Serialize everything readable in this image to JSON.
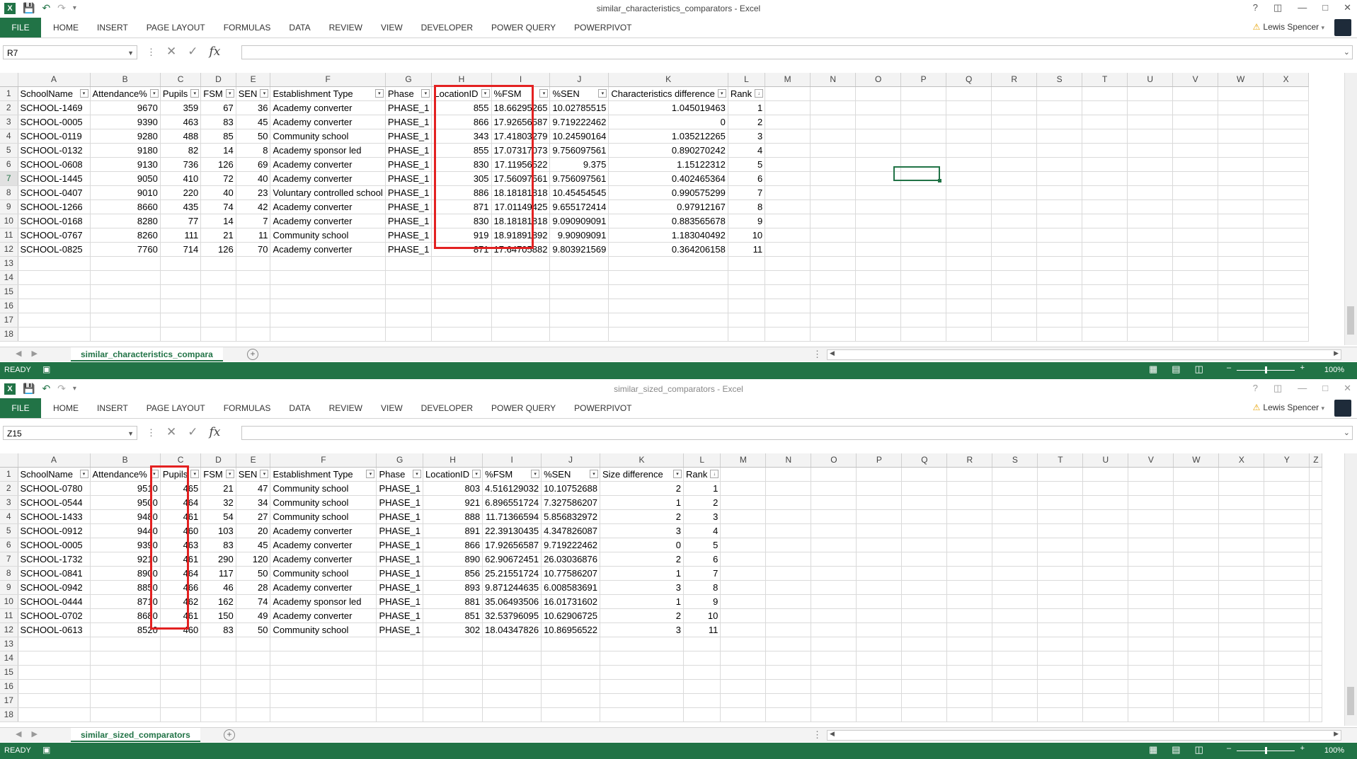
{
  "app": {
    "user_name": "Lewis Spencer",
    "file_tab": "FILE",
    "ribbon_tabs": [
      "HOME",
      "INSERT",
      "PAGE LAYOUT",
      "FORMULAS",
      "DATA",
      "REVIEW",
      "VIEW",
      "DEVELOPER",
      "POWER QUERY",
      "POWERPIVOT"
    ],
    "status_text": "READY",
    "zoom_level": "100%",
    "accent_color": "#217346",
    "highlight_color": "#e32121"
  },
  "window1": {
    "title": "similar_characteristics_comparators - Excel",
    "name_box": "R7",
    "sheet_tab": "similar_characteristics_compara",
    "column_letters": [
      "A",
      "B",
      "C",
      "D",
      "E",
      "F",
      "G",
      "H",
      "I",
      "J",
      "K",
      "L",
      "M",
      "N",
      "O",
      "P",
      "Q",
      "R",
      "S",
      "T",
      "U",
      "V",
      "W",
      "X"
    ],
    "headers": [
      "SchoolName",
      "Attendance%",
      "Pupils",
      "FSM",
      "SEN",
      "Establishment Type",
      "Phase",
      "LocationID",
      "%FSM",
      "%SEN",
      "Characteristics difference",
      "Rank"
    ],
    "rows": [
      [
        "SCHOOL-1469",
        "9670",
        "359",
        "67",
        "36",
        "Academy converter",
        "PHASE_1",
        "855",
        "18.66295265",
        "10.02785515",
        "1.045019463",
        "1"
      ],
      [
        "SCHOOL-0005",
        "9390",
        "463",
        "83",
        "45",
        "Academy converter",
        "PHASE_1",
        "866",
        "17.92656587",
        "9.719222462",
        "0",
        "2"
      ],
      [
        "SCHOOL-0119",
        "9280",
        "488",
        "85",
        "50",
        "Community school",
        "PHASE_1",
        "343",
        "17.41803279",
        "10.24590164",
        "1.035212265",
        "3"
      ],
      [
        "SCHOOL-0132",
        "9180",
        "82",
        "14",
        "8",
        "Academy sponsor led",
        "PHASE_1",
        "855",
        "17.07317073",
        "9.756097561",
        "0.890270242",
        "4"
      ],
      [
        "SCHOOL-0608",
        "9130",
        "736",
        "126",
        "69",
        "Academy converter",
        "PHASE_1",
        "830",
        "17.11956522",
        "9.375",
        "1.15122312",
        "5"
      ],
      [
        "SCHOOL-1445",
        "9050",
        "410",
        "72",
        "40",
        "Academy converter",
        "PHASE_1",
        "305",
        "17.56097561",
        "9.756097561",
        "0.402465364",
        "6"
      ],
      [
        "SCHOOL-0407",
        "9010",
        "220",
        "40",
        "23",
        "Voluntary controlled school",
        "PHASE_1",
        "886",
        "18.18181818",
        "10.45454545",
        "0.990575299",
        "7"
      ],
      [
        "SCHOOL-1266",
        "8660",
        "435",
        "74",
        "42",
        "Academy converter",
        "PHASE_1",
        "871",
        "17.01149425",
        "9.655172414",
        "0.97912167",
        "8"
      ],
      [
        "SCHOOL-0168",
        "8280",
        "77",
        "14",
        "7",
        "Academy converter",
        "PHASE_1",
        "830",
        "18.18181818",
        "9.090909091",
        "0.883565678",
        "9"
      ],
      [
        "SCHOOL-0767",
        "8260",
        "111",
        "21",
        "11",
        "Community school",
        "PHASE_1",
        "919",
        "18.91891892",
        "9.90909091",
        "1.183040492",
        "10"
      ],
      [
        "SCHOOL-0825",
        "7760",
        "714",
        "126",
        "70",
        "Academy converter",
        "PHASE_1",
        "871",
        "17.64705882",
        "9.803921569",
        "0.364206158",
        "11"
      ]
    ],
    "row_numbers": [
      "1",
      "2",
      "3",
      "4",
      "5",
      "6",
      "7",
      "8",
      "9",
      "10",
      "11",
      "12",
      "13",
      "14",
      "15",
      "16",
      "17",
      "18"
    ]
  },
  "window2": {
    "title": "similar_sized_comparators - Excel",
    "name_box": "Z15",
    "sheet_tab": "similar_sized_comparators",
    "column_letters": [
      "A",
      "B",
      "C",
      "D",
      "E",
      "F",
      "G",
      "H",
      "I",
      "J",
      "K",
      "L",
      "M",
      "N",
      "O",
      "P",
      "Q",
      "R",
      "S",
      "T",
      "U",
      "V",
      "W",
      "X",
      "Y",
      "Z"
    ],
    "headers": [
      "SchoolName",
      "Attendance%",
      "Pupils",
      "FSM",
      "SEN",
      "Establishment Type",
      "Phase",
      "LocationID",
      "%FSM",
      "%SEN",
      "Size difference",
      "Rank"
    ],
    "rows": [
      [
        "SCHOOL-0780",
        "9510",
        "465",
        "21",
        "47",
        "Community school",
        "PHASE_1",
        "803",
        "4.516129032",
        "10.10752688",
        "2",
        "1"
      ],
      [
        "SCHOOL-0544",
        "9500",
        "464",
        "32",
        "34",
        "Community school",
        "PHASE_1",
        "921",
        "6.896551724",
        "7.327586207",
        "1",
        "2"
      ],
      [
        "SCHOOL-1433",
        "9480",
        "461",
        "54",
        "27",
        "Community school",
        "PHASE_1",
        "888",
        "11.71366594",
        "5.856832972",
        "2",
        "3"
      ],
      [
        "SCHOOL-0912",
        "9440",
        "460",
        "103",
        "20",
        "Academy converter",
        "PHASE_1",
        "891",
        "22.39130435",
        "4.347826087",
        "3",
        "4"
      ],
      [
        "SCHOOL-0005",
        "9390",
        "463",
        "83",
        "45",
        "Academy converter",
        "PHASE_1",
        "866",
        "17.92656587",
        "9.719222462",
        "0",
        "5"
      ],
      [
        "SCHOOL-1732",
        "9210",
        "461",
        "290",
        "120",
        "Academy converter",
        "PHASE_1",
        "890",
        "62.90672451",
        "26.03036876",
        "2",
        "6"
      ],
      [
        "SCHOOL-0841",
        "8900",
        "464",
        "117",
        "50",
        "Community school",
        "PHASE_1",
        "856",
        "25.21551724",
        "10.77586207",
        "1",
        "7"
      ],
      [
        "SCHOOL-0942",
        "8850",
        "466",
        "46",
        "28",
        "Academy converter",
        "PHASE_1",
        "893",
        "9.871244635",
        "6.008583691",
        "3",
        "8"
      ],
      [
        "SCHOOL-0444",
        "8710",
        "462",
        "162",
        "74",
        "Academy sponsor led",
        "PHASE_1",
        "881",
        "35.06493506",
        "16.01731602",
        "1",
        "9"
      ],
      [
        "SCHOOL-0702",
        "8680",
        "461",
        "150",
        "49",
        "Academy converter",
        "PHASE_1",
        "851",
        "32.53796095",
        "10.62906725",
        "2",
        "10"
      ],
      [
        "SCHOOL-0613",
        "8520",
        "460",
        "83",
        "50",
        "Community school",
        "PHASE_1",
        "302",
        "18.04347826",
        "10.86956522",
        "3",
        "11"
      ]
    ],
    "row_numbers": [
      "1",
      "2",
      "3",
      "4",
      "5",
      "6",
      "7",
      "8",
      "9",
      "10",
      "11",
      "12",
      "13",
      "14",
      "15",
      "16",
      "17",
      "18"
    ]
  }
}
